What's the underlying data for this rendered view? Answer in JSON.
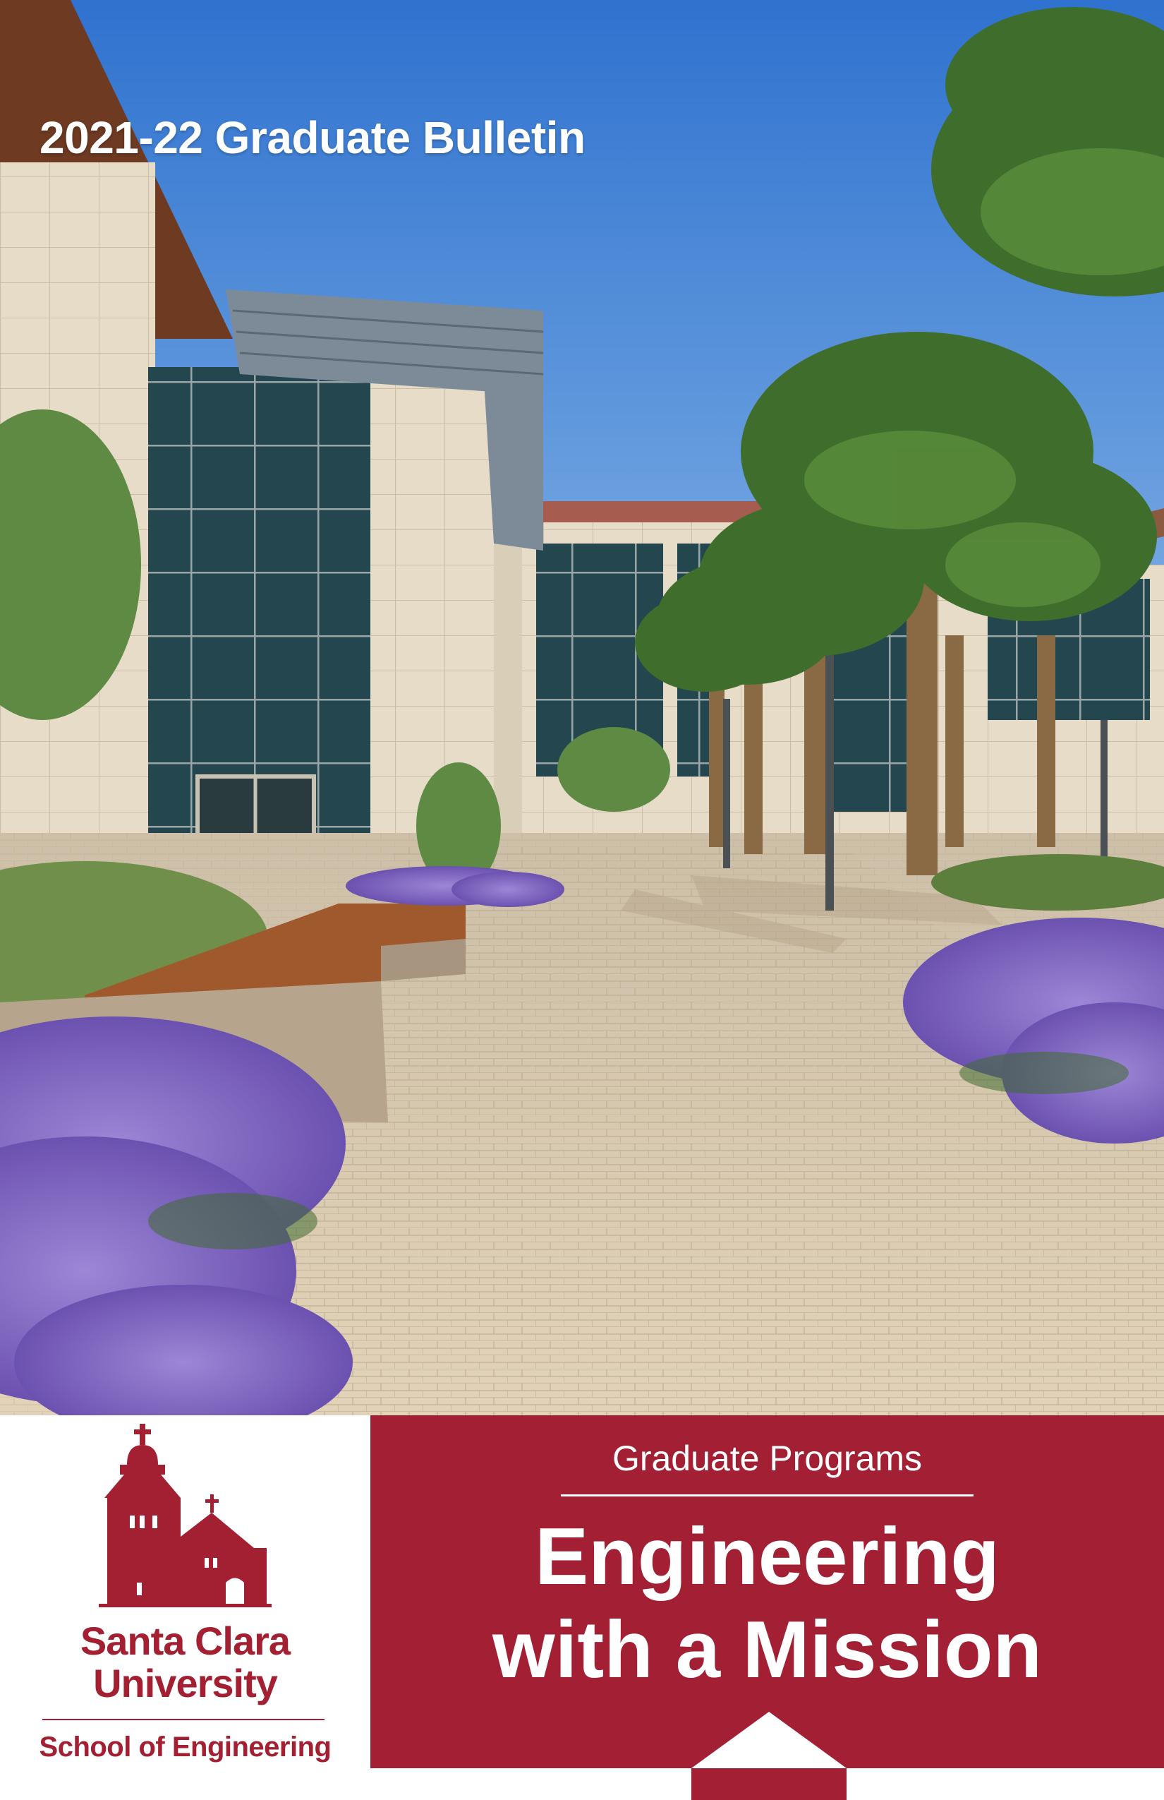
{
  "cover": {
    "bulletin_title": "2021-22 Graduate Bulletin"
  },
  "photo": {
    "subject": "campus-courtyard-photo",
    "colors": {
      "sky": "#4f8fd8",
      "paving": "#d9c8ad",
      "flowers": "#8a6fc8",
      "palms": "#3d6b2b"
    }
  },
  "logo": {
    "university_line1": "Santa Clara",
    "university_line2": "University",
    "school": "School of Engineering",
    "icon": "mission-church-icon",
    "color": "#a32033"
  },
  "banner": {
    "programs_label": "Graduate Programs",
    "headline_line1": "Engineering",
    "headline_line2": "with a Mission",
    "color": "#a31f34"
  }
}
